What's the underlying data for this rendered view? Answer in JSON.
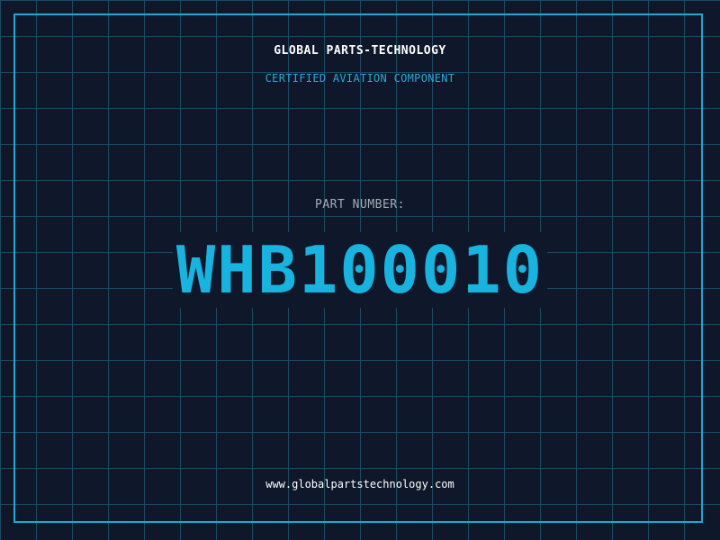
{
  "header": {
    "company_name": "GLOBAL PARTS-TECHNOLOGY",
    "subtitle": "CERTIFIED AVIATION COMPONENT"
  },
  "part": {
    "label": "PART NUMBER:",
    "number": "WHB100010"
  },
  "footer": {
    "website": "www.globalpartstechnology.com"
  },
  "colors": {
    "background": "#0f172a",
    "grid_line": "#1d4a63",
    "accent": "#18b3de",
    "frame": "#1fa8d6"
  }
}
